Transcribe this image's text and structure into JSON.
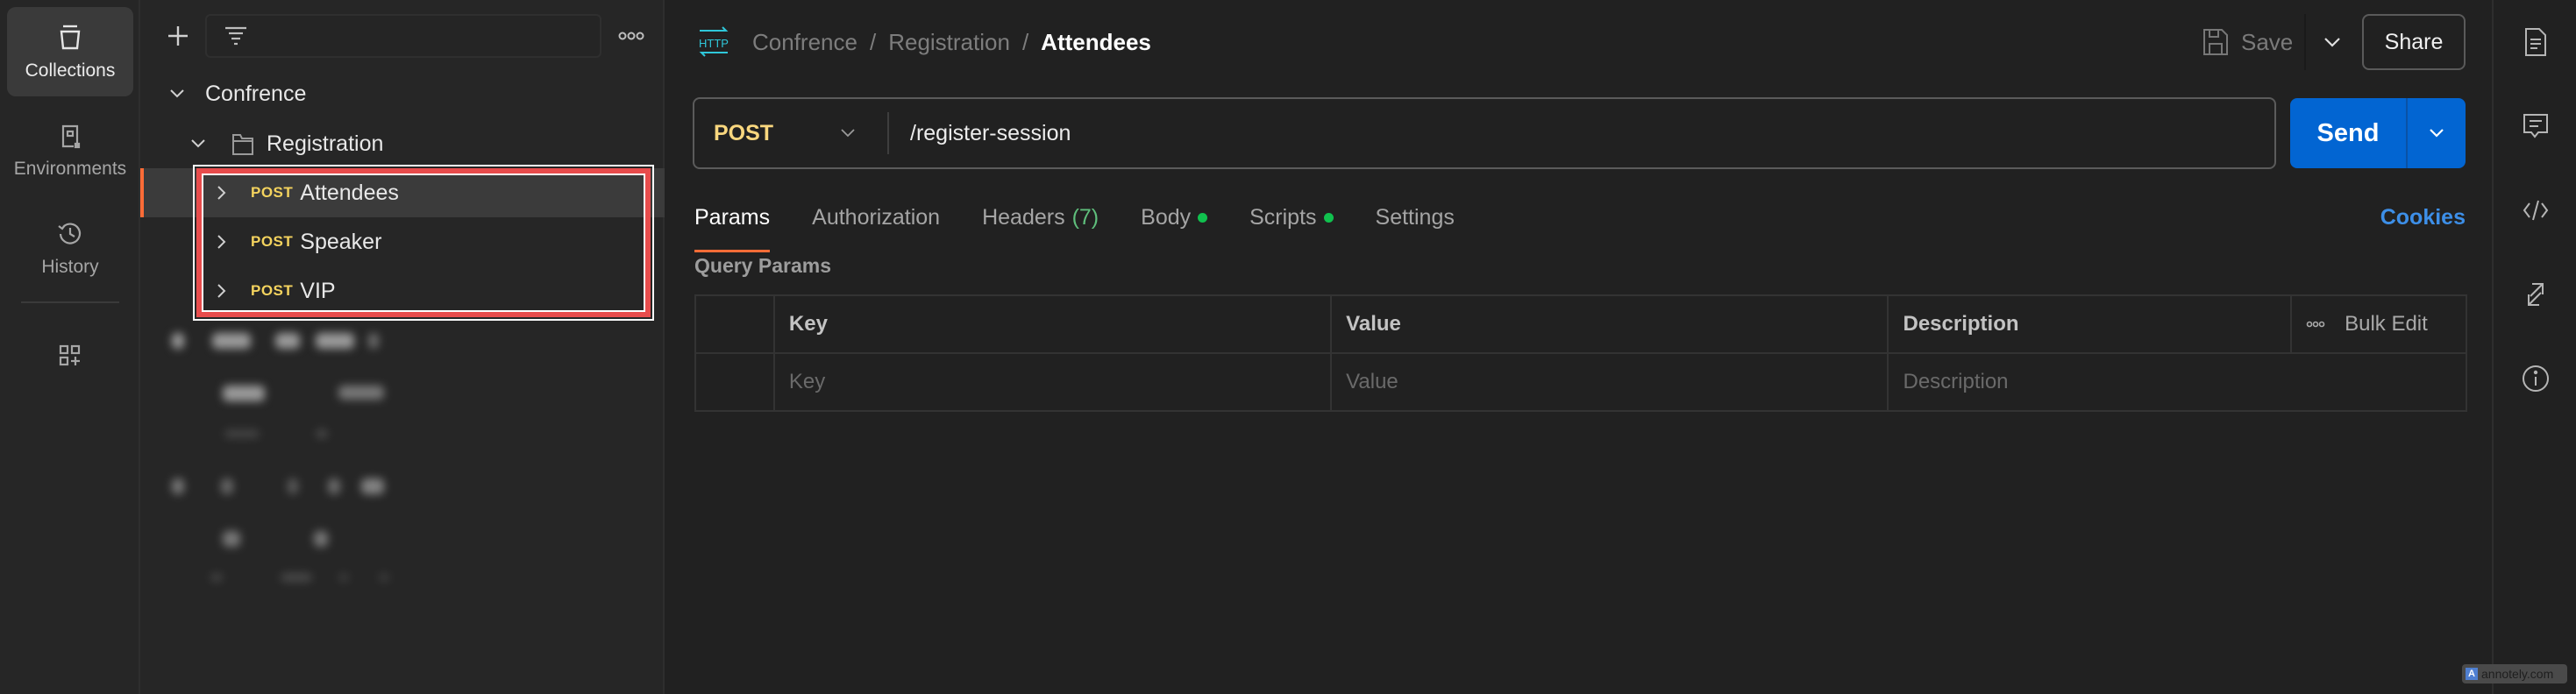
{
  "rail": {
    "items": [
      {
        "label": "Collections",
        "icon": "collections-icon",
        "active": true
      },
      {
        "label": "Environments",
        "icon": "environments-icon",
        "active": false
      },
      {
        "label": "History",
        "icon": "history-icon",
        "active": false
      }
    ],
    "extra_icon": "add-workbench-icon"
  },
  "sidebar": {
    "filter_placeholder": "",
    "tree": {
      "collection": "Confrence",
      "folder": "Registration",
      "requests": [
        {
          "method": "POST",
          "name": "Attendees",
          "selected": true
        },
        {
          "method": "POST",
          "name": "Speaker",
          "selected": false
        },
        {
          "method": "POST",
          "name": "VIP",
          "selected": false
        }
      ]
    }
  },
  "header": {
    "protocol_icon": "HTTP",
    "breadcrumb": [
      "Confrence",
      "Registration",
      "Attendees"
    ],
    "breadcrumb_sep": "/",
    "save_label": "Save",
    "share_label": "Share"
  },
  "request": {
    "method": "POST",
    "url": "/register-session",
    "send_label": "Send"
  },
  "tabs": [
    {
      "label": "Params",
      "active": true
    },
    {
      "label": "Authorization"
    },
    {
      "label": "Headers",
      "count": "(7)"
    },
    {
      "label": "Body",
      "dot": true
    },
    {
      "label": "Scripts",
      "dot": true
    },
    {
      "label": "Settings"
    }
  ],
  "cookies_label": "Cookies",
  "query_params": {
    "title": "Query Params",
    "headers": [
      "Key",
      "Value",
      "Description"
    ],
    "bulk_edit_label": "Bulk Edit",
    "placeholder_row": {
      "key": "Key",
      "value": "Value",
      "description": "Description"
    }
  },
  "right_bar": [
    "documentation-icon",
    "comments-icon",
    "code-icon",
    "related-collections-icon",
    "info-icon"
  ],
  "colors": {
    "accent": "#ff6c37",
    "send": "#0265d2",
    "method_post": "#f4d35e",
    "link": "#3d8fe8",
    "status_dot": "#10c14e",
    "highlight_box": "#e84c4c"
  },
  "watermark": "annotely.com"
}
